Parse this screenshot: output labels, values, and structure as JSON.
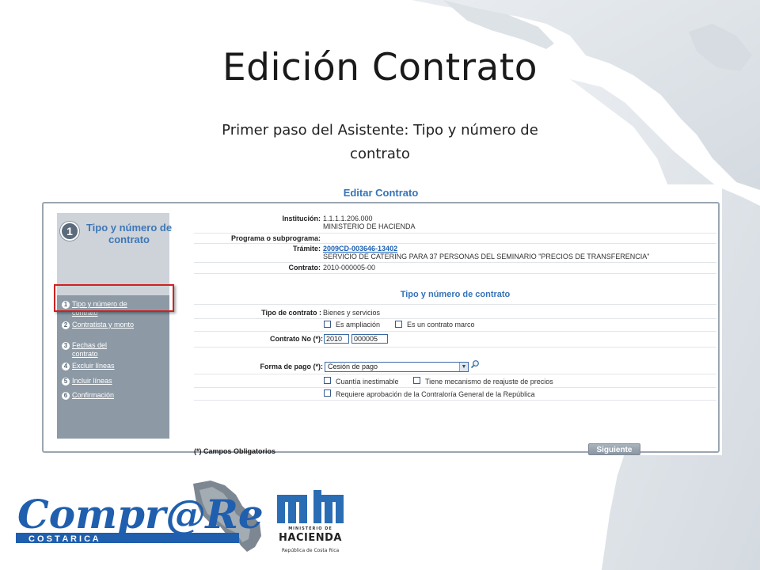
{
  "slide": {
    "title": "Edición Contrato",
    "subtitle": "Primer paso del Asistente: Tipo y número de contrato"
  },
  "screenshot": {
    "heading": "Editar Contrato",
    "step_badge": "1",
    "step_title": "Tipo y número de contrato",
    "steps": [
      {
        "num": "1",
        "label": "Tipo y número de contrato"
      },
      {
        "num": "2",
        "label": "Contratista y monto"
      },
      {
        "num": "3",
        "label": "Fechas del contrato"
      },
      {
        "num": "4",
        "label": "Excluir líneas"
      },
      {
        "num": "5",
        "label": "Incluir líneas"
      },
      {
        "num": "6",
        "label": "Confirmación"
      }
    ],
    "info": {
      "institucion_label": "Institución:",
      "institucion_code": "1.1.1.1.206.000",
      "institucion_name": "MINISTERIO DE HACIENDA",
      "programa_label": "Programa o subprograma:",
      "tramite_label": "Trámite:",
      "tramite_link": "2009CD-003646-13402",
      "tramite_desc": "SERVICIO DE CATERING PARA 37 PERSONAS DEL SEMINARIO \"PRECIOS DE TRANSFERENCIA\"",
      "contrato_label": "Contrato:",
      "contrato_value": "2010-000005-00"
    },
    "form": {
      "title": "Tipo y número de contrato",
      "tipo_label": "Tipo de contrato :",
      "tipo_value": "Bienes y servicios",
      "cb_ampliacion": "Es ampliación",
      "cb_marco": "Es un contrato marco",
      "contrato_no_label": "Contrato No (*):",
      "contrato_year": "2010",
      "contrato_num": "000005",
      "forma_pago_label": "Forma de pago (*):",
      "forma_pago_value": "Cesión de pago",
      "cb_cuantia": "Cuantía inestimable",
      "cb_reajuste": "Tiene mecanismo de reajuste de precios",
      "cb_aprobacion": "Requiere aprobación de la Contraloría General de la República",
      "required_note": "(*) Campos Obligatorios",
      "next_label": "Siguiente"
    }
  },
  "logos": {
    "comprared": "Compr@Red",
    "comprared_sub": "C O S T A R I C A",
    "hacienda_line1": "MINISTERIO DE",
    "hacienda_line2": "HACIENDA",
    "hacienda_line3": "República de Costa Rica"
  },
  "colors": {
    "accent_blue": "#3673b8",
    "nav_bg": "#8d9aa6",
    "highlight_red": "#d02020",
    "comprared_blue": "#1f5fae"
  }
}
